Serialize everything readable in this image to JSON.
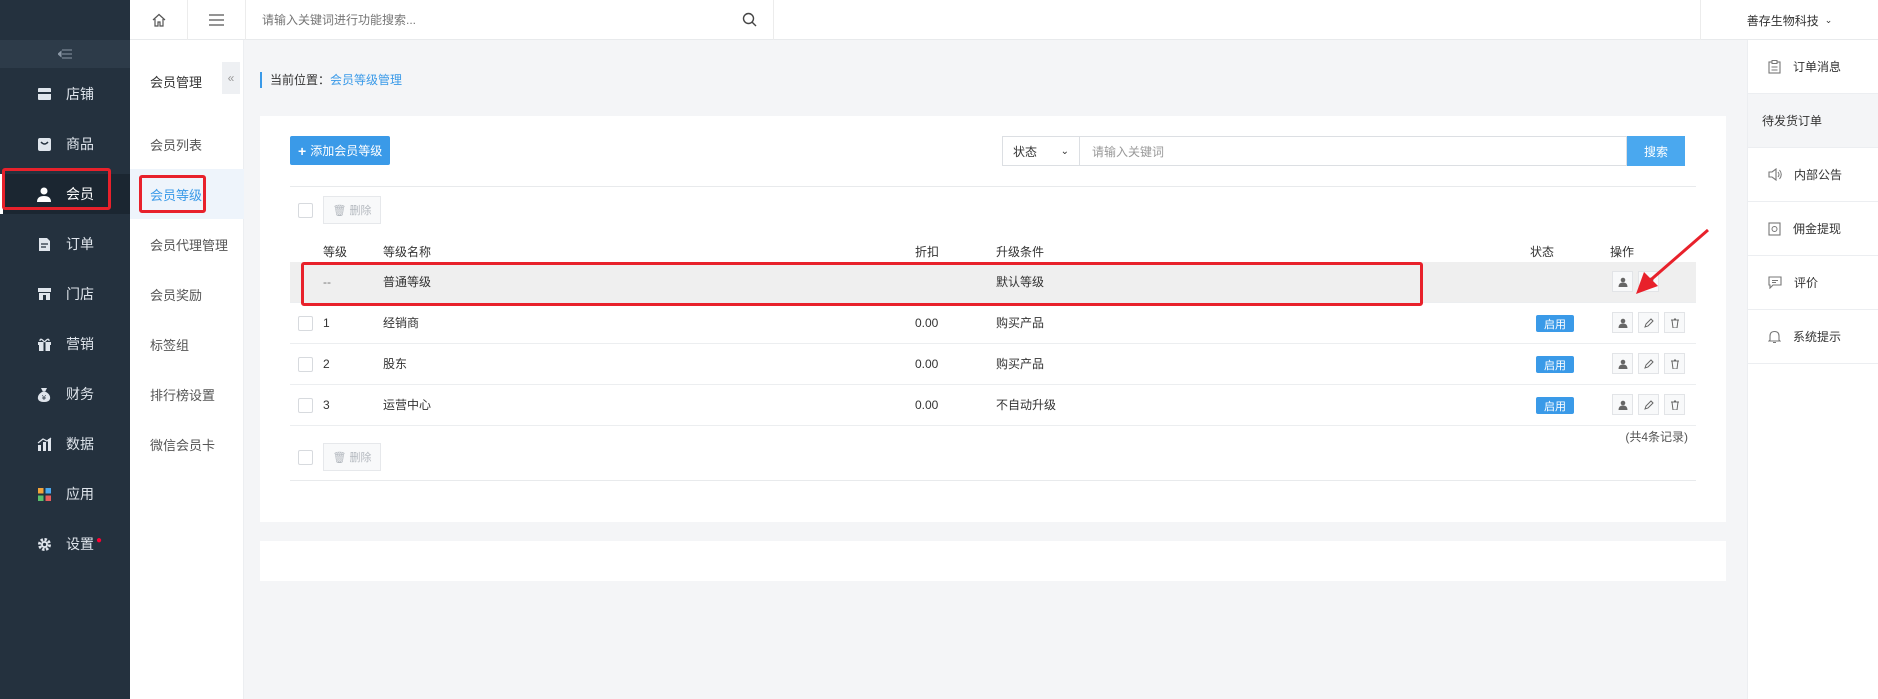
{
  "topbar": {
    "search_placeholder": "请输入关键词进行功能搜索...",
    "company": "善存生物科技"
  },
  "sidebar": {
    "items": [
      {
        "label": "店铺",
        "icon": "store-icon"
      },
      {
        "label": "商品",
        "icon": "goods-icon"
      },
      {
        "label": "会员",
        "icon": "user-icon"
      },
      {
        "label": "订单",
        "icon": "order-icon"
      },
      {
        "label": "门店",
        "icon": "shop-icon"
      },
      {
        "label": "营销",
        "icon": "gift-icon"
      },
      {
        "label": "财务",
        "icon": "money-bag-icon"
      },
      {
        "label": "数据",
        "icon": "chart-icon"
      },
      {
        "label": "应用",
        "icon": "apps-icon"
      },
      {
        "label": "设置",
        "icon": "gear-icon"
      }
    ]
  },
  "submenu": {
    "title": "会员管理",
    "items": [
      "会员列表",
      "会员等级",
      "会员代理管理",
      "会员奖励",
      "标签组",
      "排行榜设置",
      "微信会员卡"
    ]
  },
  "breadcrumb": {
    "prefix": "当前位置：",
    "current": "会员等级管理"
  },
  "toolbar": {
    "add_label": "添加会员等级",
    "status_label": "状态",
    "keyword_placeholder": "请输入关键词",
    "search_label": "搜索",
    "delete_label": "删除"
  },
  "table": {
    "headers": {
      "level": "等级",
      "name": "等级名称",
      "discount": "折扣",
      "condition": "升级条件",
      "status": "状态",
      "ops": "操作"
    },
    "rows": [
      {
        "level": "--",
        "name": "普通等级",
        "discount": "",
        "condition": "默认等级",
        "status": ""
      },
      {
        "level": "1",
        "name": "经销商",
        "discount": "0.00",
        "condition": "购买产品",
        "status": "启用"
      },
      {
        "level": "2",
        "name": "股东",
        "discount": "0.00",
        "condition": "购买产品",
        "status": "启用"
      },
      {
        "level": "3",
        "name": "运营中心",
        "discount": "0.00",
        "condition": "不自动升级",
        "status": "启用"
      }
    ],
    "total": "(共4条记录)"
  },
  "right_panel": {
    "items": [
      "订单消息",
      "待发货订单",
      "内部公告",
      "佣金提现",
      "评价",
      "系统提示"
    ]
  },
  "colors": {
    "accent": "#3a9ae8",
    "sidebar_bg": "#24313e",
    "annotation": "#e8212b"
  }
}
